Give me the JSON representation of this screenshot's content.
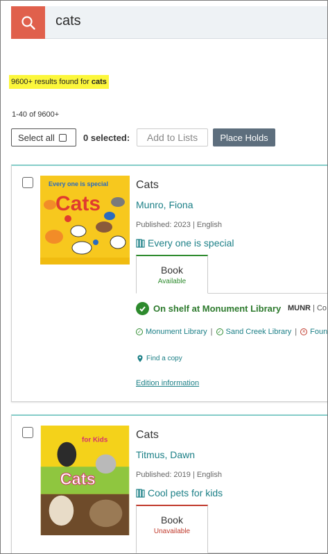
{
  "search": {
    "query": "cats",
    "icon": "search-icon",
    "button_color": "#e0604c"
  },
  "results_summary": {
    "count_text": "9600+ results found for ",
    "query_bold": "cats",
    "range_text": "1-40 of 9600+"
  },
  "toolbar": {
    "select_all_label": "Select all",
    "selected_label": "0 selected:",
    "add_to_lists_label": "Add to Lists",
    "place_holds_label": "Place Holds"
  },
  "results": [
    {
      "title": "Cats",
      "author": "Munro, Fiona",
      "published": "Published: 2023 | English",
      "series": "Every one is special",
      "cover_title": "Cats",
      "cover_tagline": "Every one is special",
      "format": {
        "name": "Book",
        "status": "Available"
      },
      "availability": "On shelf at Monument Library",
      "call_code": "MUNR",
      "call_rest": " | Co",
      "libraries": [
        {
          "name": "Monument Library",
          "state": "available"
        },
        {
          "name": "Sand Creek Library",
          "state": "available"
        },
        {
          "name": "Foun",
          "state": "unavailable"
        }
      ],
      "find_copy": "Find a copy",
      "edition_info": "Edition information"
    },
    {
      "title": "Cats",
      "author": "Titmus, Dawn",
      "published": "Published: 2019 | English",
      "series": "Cool pets for kids",
      "cover_title": "Cats",
      "cover_tagline": "for Kids",
      "format": {
        "name": "Book",
        "status": "Unavailable"
      }
    }
  ],
  "colors": {
    "accent_teal": "#1b7f86",
    "available_green": "#2d8a2d",
    "unavailable_red": "#c0392b",
    "highlight_yellow": "#fcf73b"
  }
}
